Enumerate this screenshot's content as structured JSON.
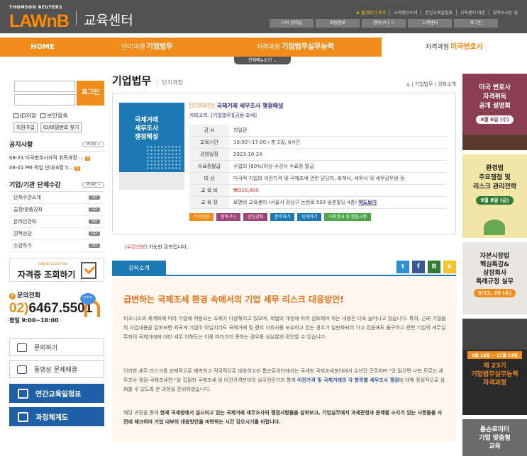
{
  "header": {
    "brand_top": "THOMSON REUTERS",
    "brand_logo": "LAWnB",
    "brand_sub": "교육센터",
    "util_links": [
      "★ 즐겨찾기 추가",
      "교육센터소개",
      "연간교육일정표",
      "교육센터 대관",
      "찾아오시는 길"
    ],
    "member_buttons": [
      "나의 강의실",
      "회원정보",
      "장바구니 ⚆",
      "고객센터",
      "로그인"
    ]
  },
  "gnb": {
    "items": [
      {
        "label": "HOME",
        "prefix": "",
        "highlight": ""
      },
      {
        "label": "기업법무",
        "prefix": "단기과정",
        "highlight": ""
      },
      {
        "label": "기업법무실무능력",
        "prefix": "자격과정",
        "highlight": ""
      },
      {
        "label": "",
        "prefix": "자격과정",
        "highlight": "미국변호사"
      }
    ],
    "all_menu": "전체메뉴보기 ⌄"
  },
  "left": {
    "login_button": "로그인",
    "save_id": "ID저장",
    "secure_login": "보안접속",
    "join": "회원가입",
    "find_id": "ID/비밀번호 찾기",
    "notice_title": "공지사항",
    "more": "MORE +",
    "notices": [
      "08-24  미국변호사자격 취득과정 ...",
      "08-01  PM 작업 안내(8월 5..."
    ],
    "biz_title": "기업/기관 단체수강",
    "biz_items": [
      "단체수강소개",
      "출장/맞춤강좌",
      "온라인강좌",
      "견적상담",
      "수강하기"
    ],
    "go": "GO",
    "license_small": "Legal License",
    "license_big": "자격증 조회하기",
    "phone_label": "문의전화",
    "phone_prefix": "02)",
    "phone_number": "6467.5501",
    "phone_hours": "평일 9:00~18:00",
    "bubble": "•••",
    "btn_inquiry": "문의하기",
    "btn_video": "동영상 문제해결",
    "btn_schedule": "연간교육일정표",
    "btn_system": "과정체계도"
  },
  "main": {
    "page_title": "기업법무",
    "page_sub": "단기과정",
    "breadcrumb": "⌂ | 기업법무 | 강좌소개",
    "book_title": "국제거래\n세무조사\n쟁점해설",
    "course_tag": "[오프라인]",
    "course_title": "국제거래 세무조사 쟁점해설",
    "course_cat": "카테고리: [기업법무][금융·조세]",
    "info": [
      {
        "label": "강 사",
        "value": "최일환"
      },
      {
        "label": "교육시간",
        "value": "10:00~17:00 / 총 1일, 6시간"
      },
      {
        "label": "강의일정",
        "value": "2023-10-24"
      },
      {
        "label": "수료증발급",
        "value": "수업의 [80%]이상 수강시 수료증 발급"
      },
      {
        "label": "대 상",
        "value": "다국적 기업의 이전가격 및 국제조세 관련 담당자, 회계사, 세무사 및 세무공무원 등"
      },
      {
        "label": "교 육 비",
        "value": "₩316,800"
      },
      {
        "label": "교 육 장",
        "value": "로앤비 교육센터 (서울시 강남구 논현로 503 송촌빌딩 4층)",
        "link": "약도보기"
      }
    ],
    "actions": [
      {
        "label": "수강신청",
        "color": "#f28c1a"
      },
      {
        "label": "장바구니",
        "color": "#a0447a"
      },
      {
        "label": "관심강좌",
        "color": "#a0447a"
      },
      {
        "label": "문의하기",
        "color": "#1c79b4"
      },
      {
        "label": "인쇄하기",
        "color": "#1c79b4"
      },
      {
        "label": "이용안내 및 환불규정",
        "color": "#4aa54a"
      }
    ],
    "apply_note_hl": "[수강신청]",
    "apply_note": " 가능한 강좌입니다.",
    "tab_intro": "강좌소개",
    "headline": "급변하는 국제조세 환경 속에서의 기업 세무 리스크 대응방안!",
    "para1": "비즈니스의 세계화에 따라 기업에 적용되는 조세가 다양해지고 있으며, 세법의 개정에 따라 검토해야 하는 내용은 더욱 늘어나고 있습니다. 특히, 근래 기업들의 사업내용을 살펴보면 외국계 기업이 아닐지라도 국제거래 및 현지 자회사를 보유하고 있는 경우가 일반화되어 가고 있음에도 불구하고 관련 기업의 세무실무자의 국제거래에 대한 세무 이해도는 이를 따라가지 못하는 경우를 심심찮게 확인할 수 있습니다.",
    "para2_a": "이러한 세무 리스크를 선제적으로 예측하고 적극적으로 대응하고자 톰슨로이터에서는 국세청 국제조세분야에서 수년간 근무하며 \"안 읽으면 나만 모르는 세무조사 쟁점-국제조세편-\"을 집필한 국제조세 및 이전가격분야의 실무전문가와 함께 ",
    "para2_b": "이전가격 및 국제거래의 각 항목별 세무조사 쟁점",
    "para2_c": "에 대해 중점적으로 살펴볼 수 있도록 본 과정을 준비하였습니다.",
    "para3_a": "해당 과정을 통해 ",
    "para3_b": "현재 국세청에서 실시되고 있는 국제거래 세무조사의 쟁점사항들을 살펴보고, 기업실무에서 과세관청과 문제될 소지가 있는 사항들을 사전에 체크하여 기업 내부의 대응방안을 마련하는 시간 갖으시기를 바랍니다."
  },
  "right": [
    {
      "title": "미국 변호사\n자격취득\n공개 설명회",
      "date": "9월 6일 (수)",
      "bg": "#8b3e4f"
    },
    {
      "title": "환경법\n주요쟁점 및\n리스크 관리전략",
      "date": "9월 8일 (금)",
      "bg": "#f2e6a6"
    },
    {
      "title": "자본시장법\n핵심특강&\n상장회사\n특례규정 실무",
      "date": "9/13, 20 (수)",
      "bg": "#e9e7e3"
    },
    {
      "title": "제 23기\n기업법무실무능력\n자격과정",
      "date": "9월 19일 ~ 11월 14일",
      "bg": "#2a2a2a"
    },
    {
      "title": "톰슨로이터\n기업 맞춤형\n교육",
      "date": "",
      "bg": "#6b6b6b"
    }
  ]
}
